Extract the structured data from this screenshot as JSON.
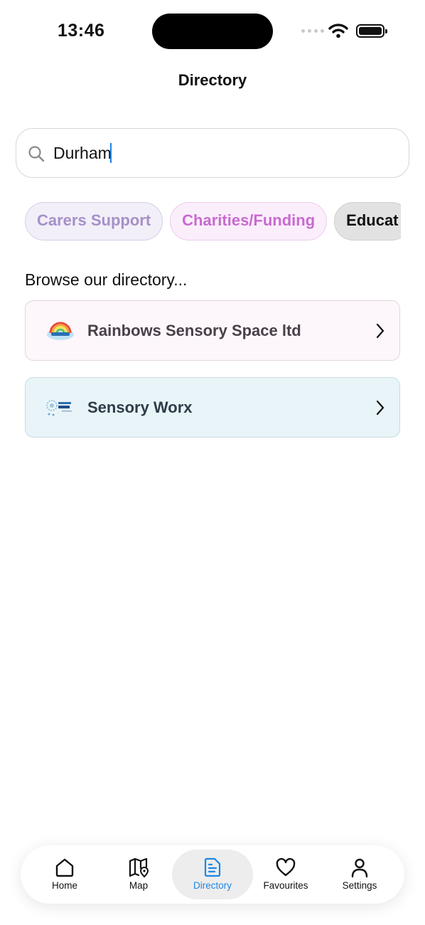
{
  "status": {
    "time": "13:46"
  },
  "header": {
    "title": "Directory"
  },
  "search": {
    "value": "Durham"
  },
  "chips": [
    {
      "label": "Carers Support"
    },
    {
      "label": "Charities/Funding"
    },
    {
      "label": "Educat"
    }
  ],
  "section": {
    "heading": "Browse our directory..."
  },
  "listings": [
    {
      "name": "Rainbows Sensory Space ltd",
      "logo": "rainbows-logo"
    },
    {
      "name": "Sensory Worx",
      "logo": "sensory-worx-logo"
    }
  ],
  "tabbar": {
    "tabs": [
      {
        "label": "Home",
        "icon": "home-icon"
      },
      {
        "label": "Map",
        "icon": "map-icon"
      },
      {
        "label": "Directory",
        "icon": "directory-icon",
        "active": true
      },
      {
        "label": "Favourites",
        "icon": "heart-icon"
      },
      {
        "label": "Settings",
        "icon": "person-icon"
      }
    ]
  },
  "colors": {
    "accent": "#1e87e5"
  }
}
